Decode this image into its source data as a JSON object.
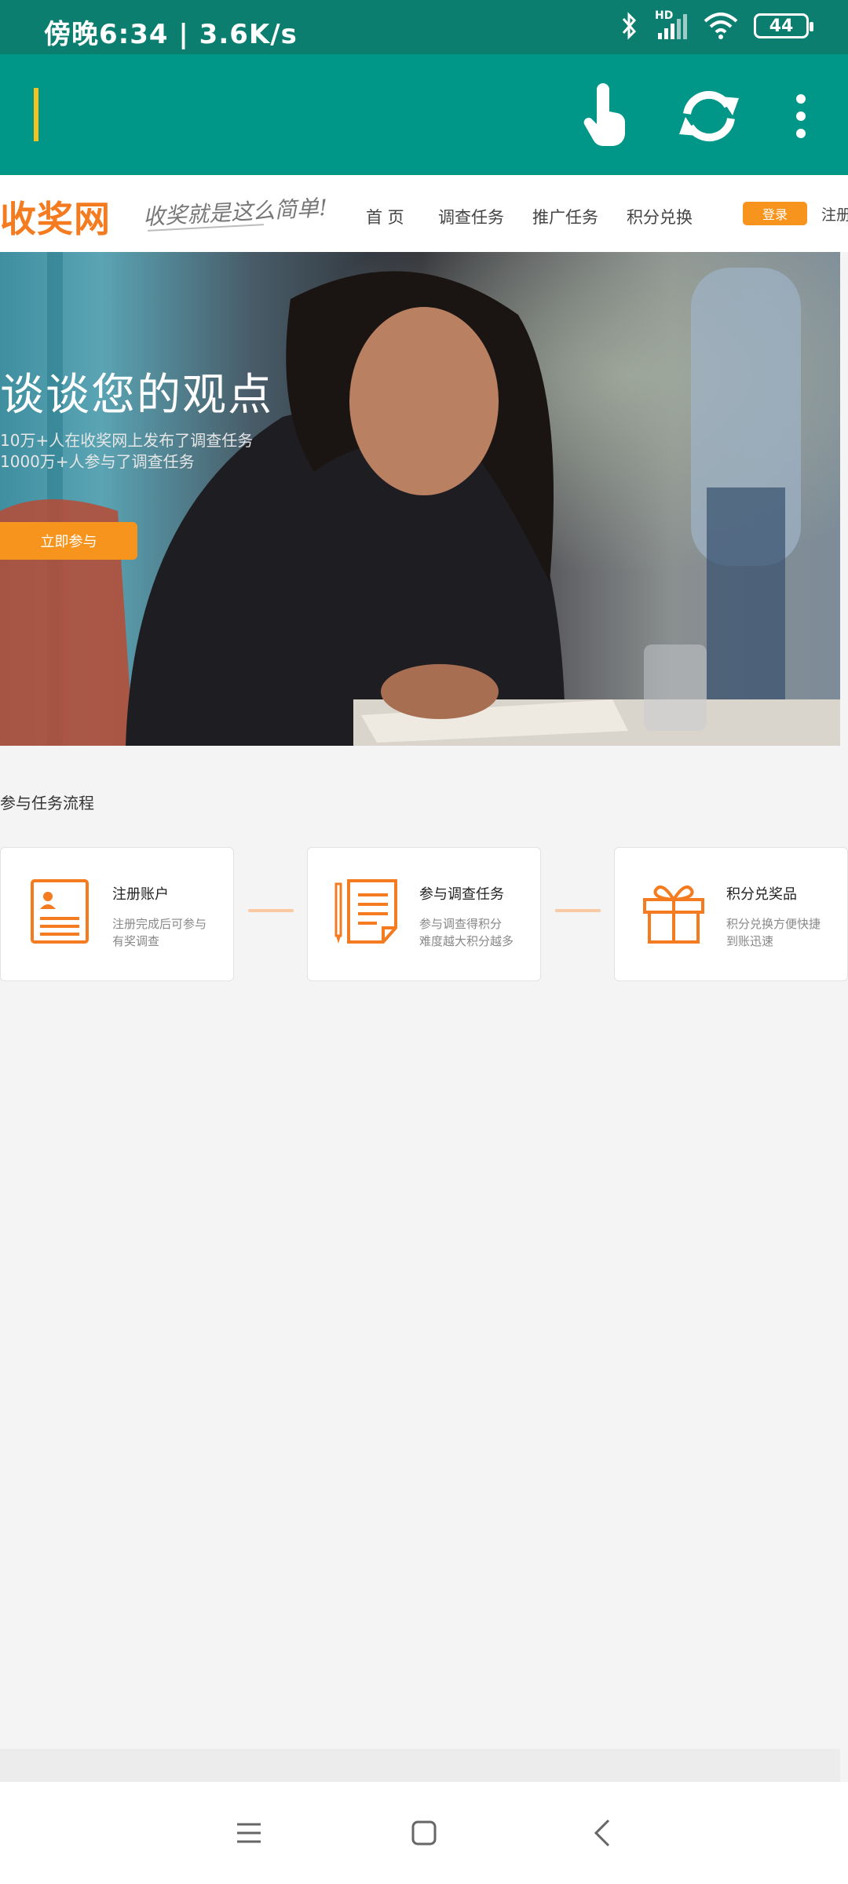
{
  "status_bar": {
    "time": "傍晚6:34 | 3.6K/s",
    "network_badge": "HD",
    "battery": "44"
  },
  "toolbar": {
    "icons": [
      "touch-icon",
      "refresh-icon",
      "more-vert-icon"
    ]
  },
  "site": {
    "logo": "收奖网",
    "slogan": "收奖就是这么简单!",
    "nav": [
      "首 页",
      "调查任务",
      "推广任务",
      "积分兑换"
    ],
    "login_label": "登录",
    "register_label": "注册"
  },
  "hero": {
    "title": "谈谈您的观点",
    "line1": "10万+人在收奖网上发布了调查任务",
    "line2": "1000万+人参与了调查任务",
    "cta_label": "立即参与"
  },
  "process": {
    "title": "参与任务流程",
    "steps": [
      {
        "title": "注册账户",
        "desc1": "注册完成后可参与",
        "desc2": "有奖调查",
        "icon": "account-card-icon"
      },
      {
        "title": "参与调查任务",
        "desc1": "参与调查得积分",
        "desc2": "难度越大积分越多",
        "icon": "survey-document-icon"
      },
      {
        "title": "积分兑奖品",
        "desc1": "积分兑换方便快捷",
        "desc2": "到账迅速",
        "icon": "gift-icon"
      }
    ]
  },
  "colors": {
    "status_bar": "#0b7e6f",
    "toolbar": "#009688",
    "accent_orange": "#f47b20",
    "button_orange": "#f7941d"
  }
}
